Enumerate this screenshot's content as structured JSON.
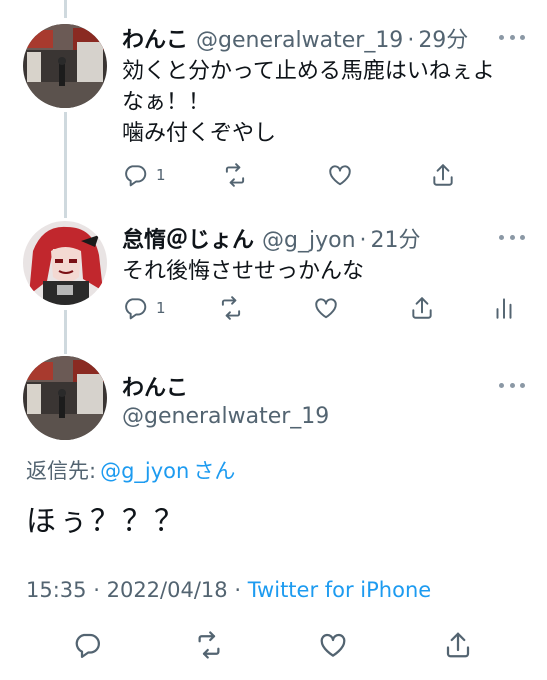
{
  "tweet1": {
    "display_name": "わんこ",
    "handle": "@generalwater_19",
    "separator": "·",
    "time": "29分",
    "text": "効くと分かって止める馬鹿はいねぇよ\nなぁ！！\n噛み付くぞやし",
    "reply_count": "1",
    "retweet_count": "",
    "like_count": ""
  },
  "tweet2": {
    "display_name": "怠惰＠じょん",
    "handle": "@g_jyon",
    "separator": "·",
    "time": "21分",
    "text": "それ後悔させせっかんな",
    "reply_count": "1"
  },
  "main_tweet": {
    "display_name": "わんこ",
    "handle": "@generalwater_19",
    "reply_prefix": "返信先:",
    "reply_mention": "@g_jyon",
    "reply_suffix": "さん",
    "text": "ほぅ？？？",
    "time": "15:35",
    "meta_sep1": "·",
    "date": "2022/04/18",
    "meta_sep2": "·",
    "source": "Twitter for iPhone"
  },
  "icons": {
    "reply": "reply-icon",
    "retweet": "retweet-icon",
    "like": "heart-icon",
    "share": "share-icon",
    "analytics": "analytics-icon",
    "more": "more-icon"
  },
  "colors": {
    "accent": "#1d9bf0",
    "secondary_text": "#536471",
    "thread_line": "#cfd9de"
  }
}
